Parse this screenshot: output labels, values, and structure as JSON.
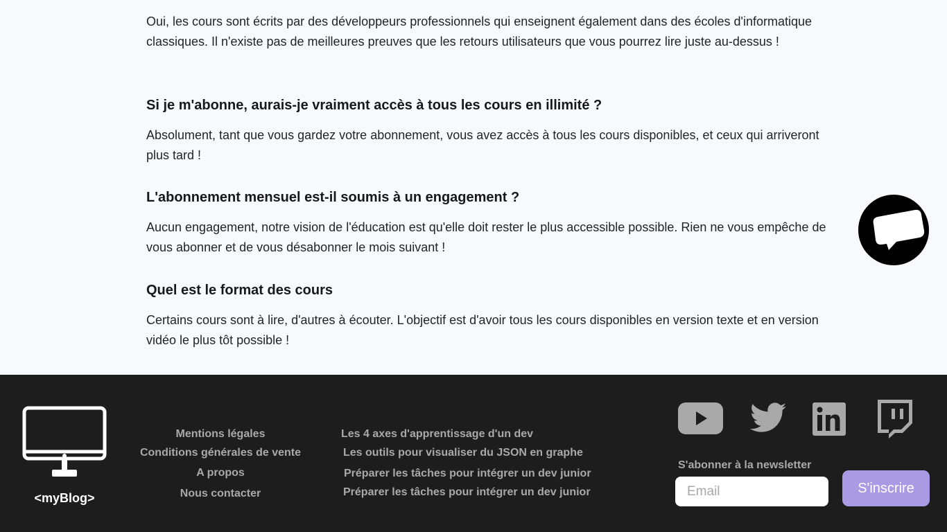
{
  "faq": [
    {
      "question": "",
      "answer": " Oui, les cours sont écrits par des développeurs professionnels qui enseignent également dans des écoles d'informatique classiques. Il n'existe pas de meilleures preuves que les retours utilisateurs que vous pourrez lire juste au-dessus !"
    },
    {
      "question": "Si je m'abonne, aurais-je vraiment accès à tous les cours en illimité ?",
      "answer": " Absolument, tant que vous gardez votre abonnement, vous avez accès à tous les cours disponibles, et ceux qui arriveront plus tard !"
    },
    {
      "question": "L'abonnement mensuel est-il soumis à un engagement ?",
      "answer": " Aucun engagement, notre vision de l'éducation est qu'elle doit rester le plus accessible possible. Rien ne vous empêche de vous abonner et de vous désabonner le mois suivant !"
    },
    {
      "question": "Quel est le format des cours",
      "answer": "Certains cours sont à lire, d'autres à écouter. L'objectif est d'avoir tous les cours disponibles en version texte et en version vidéo le plus tôt possible !"
    }
  ],
  "chat": {
    "icon": "chat-bubble-icon"
  },
  "footer": {
    "logo_text": "<myBlog>",
    "logo_icon": "monitor-icon",
    "links_col1": [
      "Mentions légales",
      "Conditions générales de vente",
      "A propos",
      "Nous contacter"
    ],
    "links_col2": [
      "Les 4 axes d'apprentissage d'un dev",
      "Les outils pour visualiser du JSON en graphe",
      "Préparer les tâches pour intégrer un dev junior",
      "Préparer les tâches pour intégrer un dev junior"
    ],
    "socials": [
      "youtube-icon",
      "twitter-icon",
      "linkedin-icon",
      "twitch-icon"
    ],
    "newsletter_title": "S'abonner à la newsletter",
    "email_placeholder": "Email",
    "subscribe_label": "S'inscrire"
  },
  "colors": {
    "page_bg": "#f8f9fc",
    "footer_bg": "#1d1d1d",
    "footer_text": "#a9a9a9",
    "accent": "#a99ae3"
  }
}
